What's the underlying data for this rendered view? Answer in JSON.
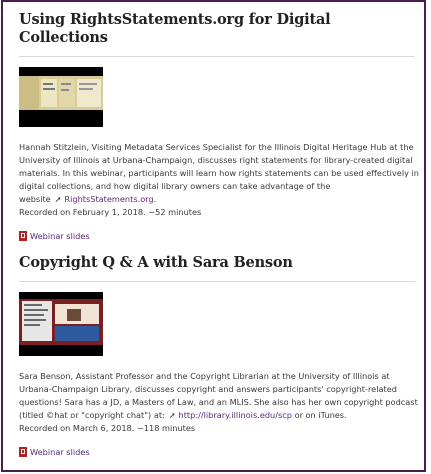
{
  "webinars": [
    {
      "title": "Using RightsStatements.org for Digital Collections",
      "desc_text": "Hannah Stitzlein, Visiting Metadata Services Specialist for the Illinois Digital Heritage Hub at the University of Illinois at Urbana-Champaign, discusses right statements for library-created digital materials. In this webinar, participants will learn how rights statements can be used effectively in digital collections, and how digital library owners can take advantage of the website",
      "link_text": "RightsStatements.org",
      "desc_after_link": ".",
      "recorded": "Recorded on February 1, 2018. ~52 minutes",
      "slides_label": "Webinar slides"
    },
    {
      "title": "Copyright Q & A with Sara Benson",
      "desc_text": "Sara Benson, Assistant Professor and the Copyright Librarian at the University of Illinois at Urbana-Champaign Library, discusses copyright and answers participants' copyright-related questions!  Sara has a JD, a Masters of Law, and an MLIS. She also has her own copyright podcast (titled ©hat or \"copyright chat\") at:",
      "link_text": "http://library.illinois.edu/scp",
      "desc_after_link": " or on iTunes.",
      "recorded": "Recorded on March 6, 2018. ~118 minutes",
      "slides_label": "Webinar slides"
    }
  ],
  "colors": {
    "border": "#4a1e4a",
    "link": "#5a2a7a",
    "pdf_icon": "#b22222"
  }
}
